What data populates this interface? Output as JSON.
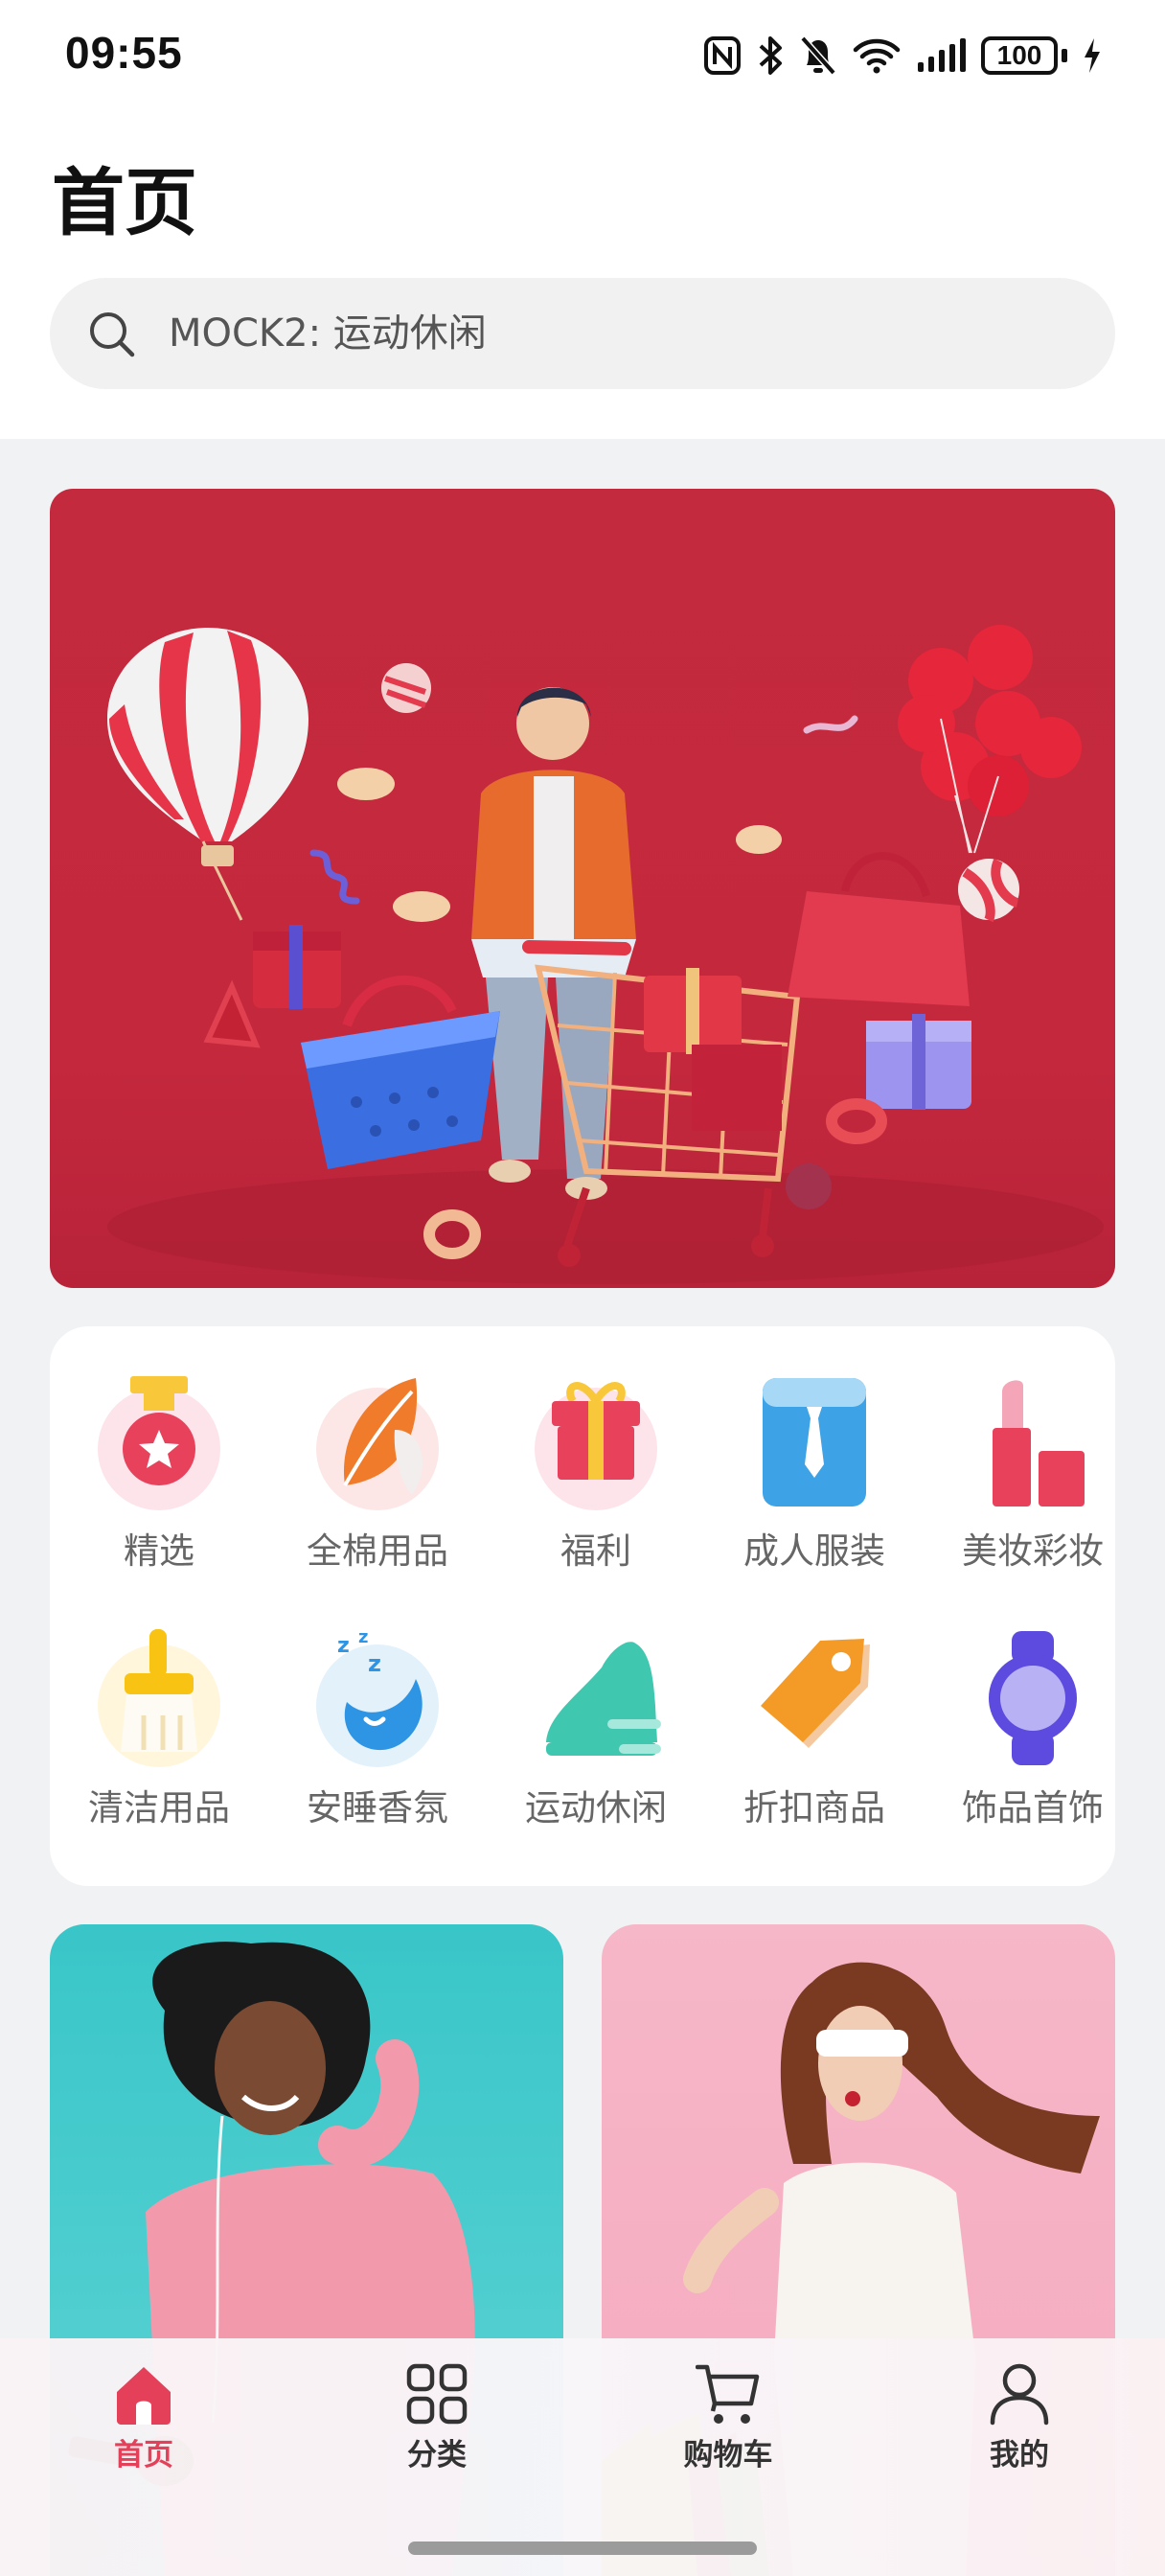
{
  "status_bar": {
    "time": "09:55",
    "battery": "100",
    "icons": [
      "nfc-icon",
      "bluetooth-icon",
      "bell-muted-icon",
      "wifi-icon",
      "signal-icon",
      "battery-icon",
      "charging-icon"
    ]
  },
  "header": {
    "title": "首页"
  },
  "search": {
    "placeholder": "MOCK2: 运动休闲",
    "icon": "search-icon"
  },
  "banner": {
    "description_icon": "shopping-banner-illustration"
  },
  "categories": [
    {
      "label": "精选",
      "icon": "medal-icon"
    },
    {
      "label": "全棉用品",
      "icon": "leaf-icon"
    },
    {
      "label": "福利",
      "icon": "gift-icon"
    },
    {
      "label": "成人服装",
      "icon": "shirt-tie-icon"
    },
    {
      "label": "美妆彩妆",
      "icon": "lipstick-icon"
    },
    {
      "label": "清洁用品",
      "icon": "brush-icon"
    },
    {
      "label": "安睡香氛",
      "icon": "sleep-moon-icon"
    },
    {
      "label": "运动休闲",
      "icon": "sneaker-icon"
    },
    {
      "label": "折扣商品",
      "icon": "price-tag-icon"
    },
    {
      "label": "饰品首饰",
      "icon": "watch-icon"
    }
  ],
  "promos": [
    {
      "icon": "woman-music-photo"
    },
    {
      "icon": "woman-shopping-photo"
    }
  ],
  "tab_bar": {
    "items": [
      {
        "label": "首页",
        "icon": "home-icon",
        "active": true
      },
      {
        "label": "分类",
        "icon": "grid-icon",
        "active": false
      },
      {
        "label": "购物车",
        "icon": "cart-icon",
        "active": false
      },
      {
        "label": "我的",
        "icon": "person-icon",
        "active": false
      }
    ]
  },
  "colors": {
    "accent": "#e4405a",
    "banner_bg": "#c4283d",
    "page_bg": "#f1f2f4"
  }
}
